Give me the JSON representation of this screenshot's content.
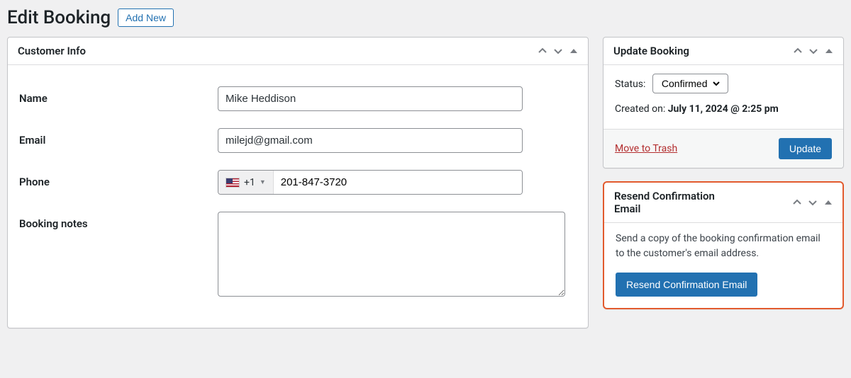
{
  "header": {
    "title": "Edit Booking",
    "add_new_label": "Add New"
  },
  "customer_info": {
    "panel_title": "Customer Info",
    "name_label": "Name",
    "name_value": "Mike Heddison",
    "email_label": "Email",
    "email_value": "milejd@gmail.com",
    "phone_label": "Phone",
    "phone_prefix": "+1",
    "phone_value": "201-847-3720",
    "notes_label": "Booking notes",
    "notes_value": ""
  },
  "update_panel": {
    "title": "Update Booking",
    "status_label": "Status:",
    "status_value": "Confirmed",
    "created_label": "Created on: ",
    "created_value": "July 11, 2024 @ 2:25 pm",
    "trash_label": "Move to Trash",
    "update_button": "Update"
  },
  "resend_panel": {
    "title": "Resend Confirmation Email",
    "description": "Send a copy of the booking confirmation email to the customer's email address.",
    "button_label": "Resend Confirmation Email"
  }
}
